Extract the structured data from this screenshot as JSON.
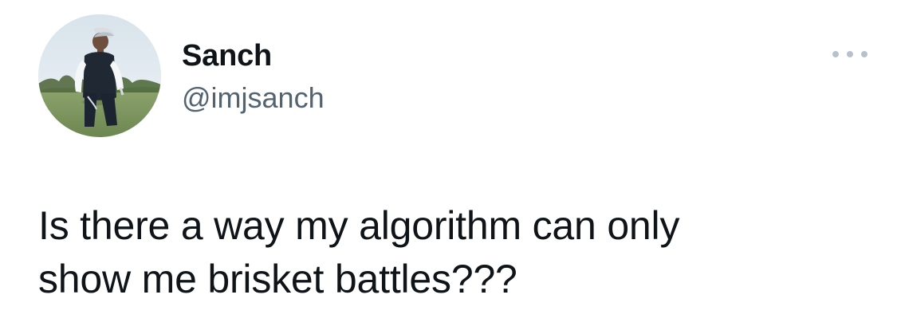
{
  "tweet": {
    "author": {
      "display_name": "Sanch",
      "handle": "@imjsanch",
      "avatar_icon": "profile-photo"
    },
    "more_menu_icon": "more-horizontal-icon",
    "text_lines": [
      "Is there a way my algorithm can only",
      "show me brisket battles???"
    ]
  }
}
